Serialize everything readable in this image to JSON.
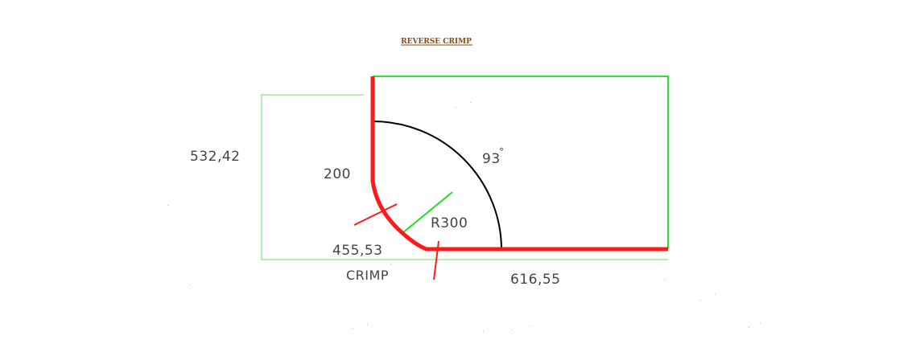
{
  "title": "REVERSE CRIMP",
  "labels": {
    "height": "532,42",
    "flange": "200",
    "angle": "93",
    "degree_mark": "°",
    "radius": "R300",
    "arc_length": "455,53",
    "crimp": "CRIMP",
    "base_length": "616,55"
  },
  "colors": {
    "profile": "#ff1a1a",
    "outline": "#33dd33",
    "arc": "#000000",
    "title": "#8b4a0b",
    "text": "#444444"
  }
}
